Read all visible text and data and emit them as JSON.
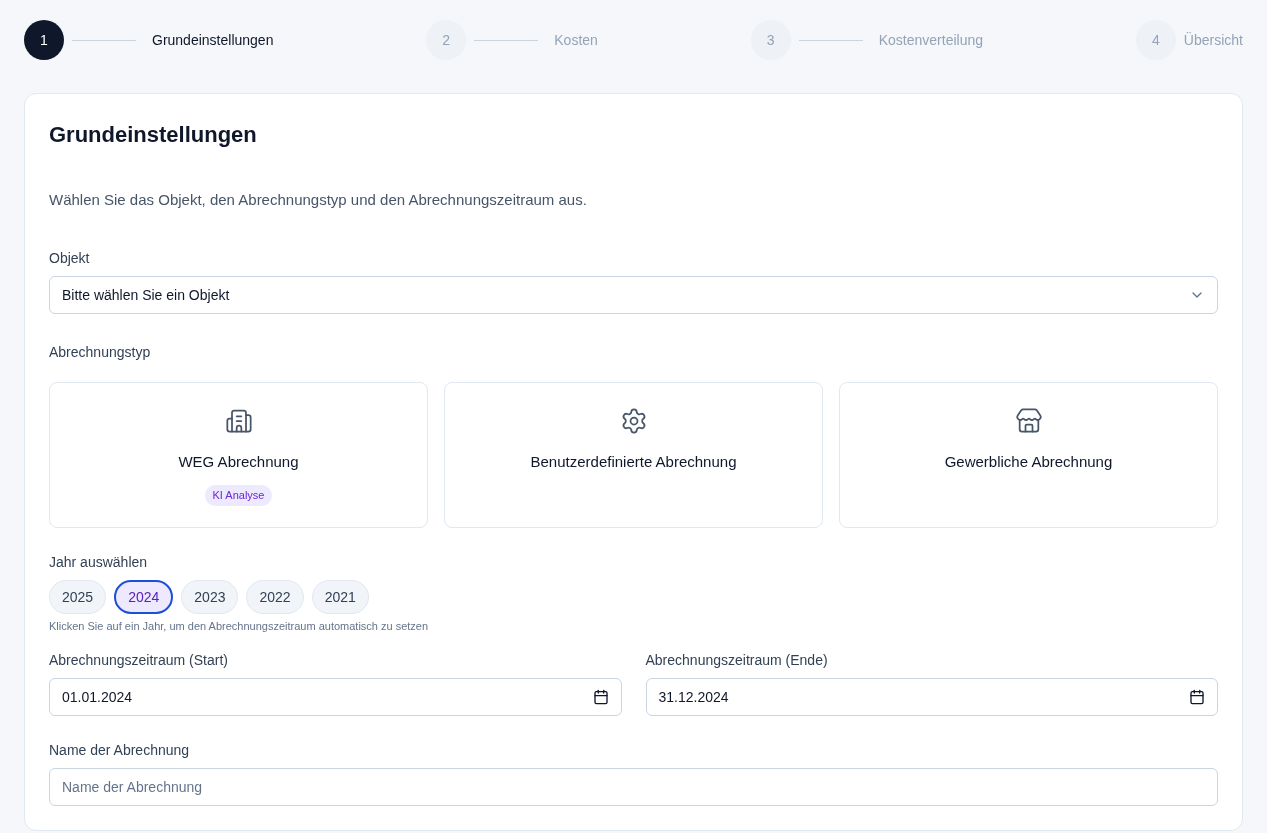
{
  "steps": [
    {
      "number": "1",
      "label": "Grundeinstellungen",
      "selected": true
    },
    {
      "number": "2",
      "label": "Kosten",
      "selected": false
    },
    {
      "number": "3",
      "label": "Kostenverteilung",
      "selected": false
    },
    {
      "number": "4",
      "label": "Übersicht",
      "selected": false
    }
  ],
  "title": "Grundeinstellungen",
  "description": "Wählen Sie das Objekt, den Abrechnungstyp und den Abrechnungszeitraum aus.",
  "object": {
    "label": "Objekt",
    "value": "Bitte wählen Sie ein Objekt"
  },
  "billing_type": {
    "label": "Abrechnungstyp",
    "options": [
      {
        "kind": "building",
        "label": "WEG Abrechnung",
        "badge": "KI Analyse",
        "selected": false
      },
      {
        "kind": "gear",
        "label": "Benutzerdefinierte Abrechnung",
        "selected": false
      },
      {
        "kind": "store",
        "label": "Gewerbliche Abrechnung",
        "selected": false
      }
    ]
  },
  "year": {
    "label": "Jahr auswählen",
    "years": [
      {
        "label": "2025",
        "selected": false
      },
      {
        "label": "2024",
        "selected": true
      },
      {
        "label": "2023",
        "selected": false
      },
      {
        "label": "2022",
        "selected": false
      },
      {
        "label": "2021",
        "selected": false
      }
    ],
    "hint": "Klicken Sie auf ein Jahr, um den Abrechnungszeitraum automatisch zu setzen"
  },
  "period": [
    {
      "label": "Abrechnungszeitraum (Start)",
      "value": "01.01.2024"
    },
    {
      "label": "Abrechnungszeitraum (Ende)",
      "value": "31.12.2024"
    }
  ],
  "name": {
    "label": "Name der Abrechnung",
    "placeholder": "Name der Abrechnung"
  }
}
